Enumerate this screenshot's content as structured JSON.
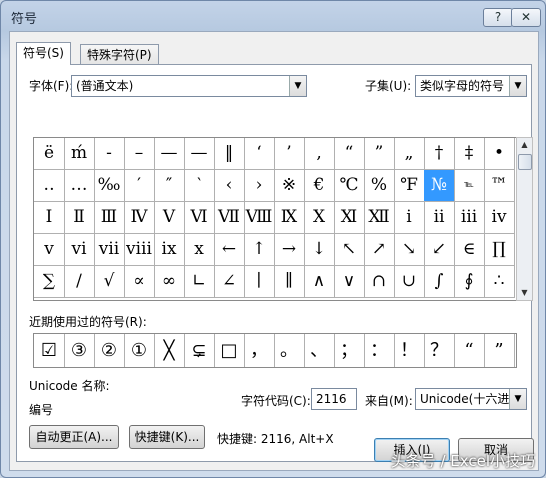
{
  "window": {
    "title": "符号",
    "help_label": "?",
    "close_label": "✕"
  },
  "tabs": [
    {
      "label": "符号(S)"
    },
    {
      "label": "特殊字符(P)"
    }
  ],
  "font": {
    "label": "字体(F):",
    "value": "(普通文本)"
  },
  "subset": {
    "label": "子集(U):",
    "value": "类似字母的符号"
  },
  "symbol_grid": {
    "rows": [
      [
        "ë",
        "ḿ",
        "-",
        "–",
        "—",
        "—",
        "‖",
        "‘",
        "’",
        "‚",
        "“",
        "”",
        "„",
        "†",
        "‡",
        "•"
      ],
      [
        "‥",
        "…",
        "‰",
        "′",
        "″",
        "‵",
        "‹",
        "›",
        "※",
        "€",
        "℃",
        "%",
        "℉",
        "№",
        "℡",
        "™"
      ],
      [
        "Ⅰ",
        "Ⅱ",
        "Ⅲ",
        "Ⅳ",
        "Ⅴ",
        "Ⅵ",
        "Ⅶ",
        "Ⅷ",
        "Ⅸ",
        "Ⅹ",
        "Ⅺ",
        "Ⅻ",
        "ⅰ",
        "ⅱ",
        "ⅲ",
        "ⅳ"
      ],
      [
        "ⅴ",
        "ⅵ",
        "ⅶ",
        "ⅷ",
        "ⅸ",
        "ⅹ",
        "←",
        "↑",
        "→",
        "↓",
        "↖",
        "↗",
        "↘",
        "↙",
        "∈",
        "∏"
      ],
      [
        "∑",
        "∕",
        "√",
        "∝",
        "∞",
        "∟",
        "∠",
        "∣",
        "∥",
        "∧",
        "∨",
        "∩",
        "∪",
        "∫",
        "∮",
        "∴"
      ]
    ],
    "selected": "№"
  },
  "recent": {
    "label": "近期使用过的符号(R):",
    "symbols": [
      "☑",
      "③",
      "②",
      "①",
      "╳",
      "⊊",
      "□",
      "，",
      "。",
      "、",
      "；",
      "：",
      "！",
      "？",
      "“",
      "”"
    ]
  },
  "unicode_name_label": "Unicode 名称:",
  "unicode_name_value": "编号",
  "char_code": {
    "label": "字符代码(C):",
    "value": "2116"
  },
  "from": {
    "label": "来自(M):",
    "value": "Unicode(十六进"
  },
  "buttons": {
    "autocorrect": "自动更正(A)...",
    "shortcut_key": "快捷键(K)...",
    "insert": "插入(I)",
    "cancel": "取消"
  },
  "shortcut_info": "快捷键: 2116, Alt+X",
  "watermark": "头条号 / Excel小技巧"
}
